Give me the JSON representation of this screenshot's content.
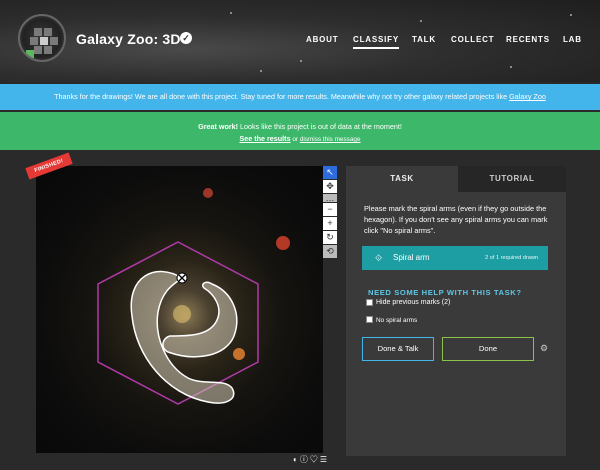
{
  "header": {
    "title": "Galaxy Zoo: 3D",
    "nav": [
      {
        "label": "ABOUT",
        "active": false
      },
      {
        "label": "CLASSIFY",
        "active": true
      },
      {
        "label": "TALK",
        "active": false
      },
      {
        "label": "COLLECT",
        "active": false
      },
      {
        "label": "RECENTS",
        "active": false
      },
      {
        "label": "LAB",
        "active": false
      }
    ]
  },
  "banner_blue": {
    "text": "Thanks for the drawings! We are all done with this project. Stay tuned for more results. Meanwhile why not try other galaxy related projects like ",
    "link": "Galaxy Zoo"
  },
  "banner_green": {
    "bold": "Great work!",
    "text": " Looks like this project is out of data at the moment!",
    "results_link": "See the results",
    "or_text": " or ",
    "dismiss_link": "dismiss this message"
  },
  "subject": {
    "badge": "FINISHED!"
  },
  "task_panel": {
    "tabs": [
      "TASK",
      "TUTORIAL"
    ],
    "instructions": "Please mark the spiral arms (even if they go outside the hexagon). If you don't see any spiral arms you can mark click \"No spiral arms\".",
    "tool": {
      "label": "Spiral arm",
      "count": "2 of 1 required drawn"
    },
    "help_title": "NEED SOME HELP WITH THIS TASK?",
    "options": [
      "Hide previous marks (2)",
      "No spiral arms"
    ],
    "done_talk": "Done & Talk",
    "done": "Done"
  },
  "icons": {
    "verified": "check-circle-icon",
    "settings": "gear-icon"
  },
  "colors": {
    "blue_banner": "#43b5ea",
    "green_banner": "#3db86a",
    "teal_button": "#1d9ea3",
    "finished_badge": "#e53935",
    "hexagon": "#b03aa8"
  }
}
